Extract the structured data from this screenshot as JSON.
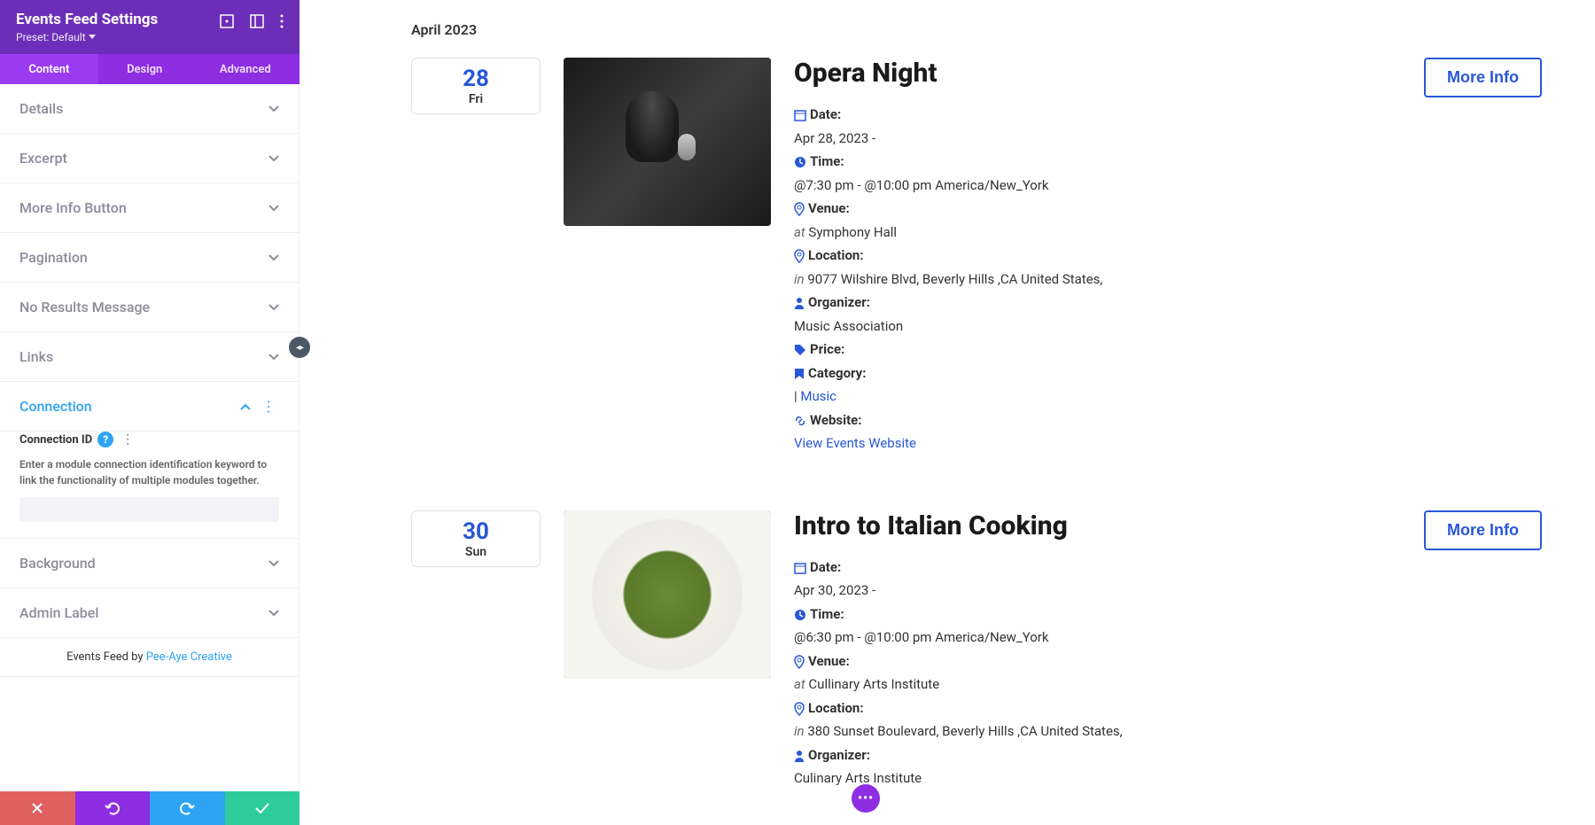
{
  "sidebar": {
    "title": "Events Feed Settings",
    "preset": "Preset: Default",
    "tabs": {
      "content": "Content",
      "design": "Design",
      "advanced": "Advanced"
    },
    "sections": {
      "details": "Details",
      "excerpt": "Excerpt",
      "more_info_button": "More Info Button",
      "pagination": "Pagination",
      "no_results": "No Results Message",
      "links": "Links",
      "connection": "Connection",
      "background": "Background",
      "admin_label": "Admin Label"
    },
    "connection": {
      "label": "Connection ID",
      "help": "?",
      "description": "Enter a module connection identification keyword to link the functionality of multiple modules together.",
      "value": ""
    },
    "footer": {
      "prefix": "Events Feed by ",
      "link": "Pee-Aye Creative"
    }
  },
  "main": {
    "month": "April 2023",
    "events": [
      {
        "day_num": "28",
        "day_name": "Fri",
        "title": "Opera Night",
        "date_label": "Date:",
        "date_value": "Apr 28, 2023 -",
        "time_label": "Time:",
        "time_start": "7:30 pm",
        "time_sep": " - ",
        "time_end": "10:00 pm",
        "time_tz": "America/New_York",
        "venue_label": "Venue:",
        "venue_prefix": "at",
        "venue_value": "Symphony Hall",
        "location_label": "Location:",
        "location_prefix": "in",
        "location_value": "9077 Wilshire Blvd, Beverly Hills ,CA United States,",
        "organizer_label": "Organizer:",
        "organizer_value": "Music Association",
        "price_label": "Price:",
        "category_label": "Category:",
        "category_sep": "|",
        "category_value": "Music",
        "website_label": "Website:",
        "website_link": "View Events Website",
        "more_info": "More Info"
      },
      {
        "day_num": "30",
        "day_name": "Sun",
        "title": "Intro to Italian Cooking",
        "date_label": "Date:",
        "date_value": "Apr 30, 2023 -",
        "time_label": "Time:",
        "time_start": "6:30 pm",
        "time_sep": " - ",
        "time_end": "10:00 pm",
        "time_tz": "America/New_York",
        "venue_label": "Venue:",
        "venue_prefix": "at",
        "venue_value": "Cullinary Arts Institute",
        "location_label": "Location:",
        "location_prefix": "in",
        "location_value": "380 Sunset Boulevard, Beverly Hills ,CA United States,",
        "organizer_label": "Organizer:",
        "organizer_value": "Culinary Arts Institute",
        "more_info": "More Info"
      }
    ]
  }
}
